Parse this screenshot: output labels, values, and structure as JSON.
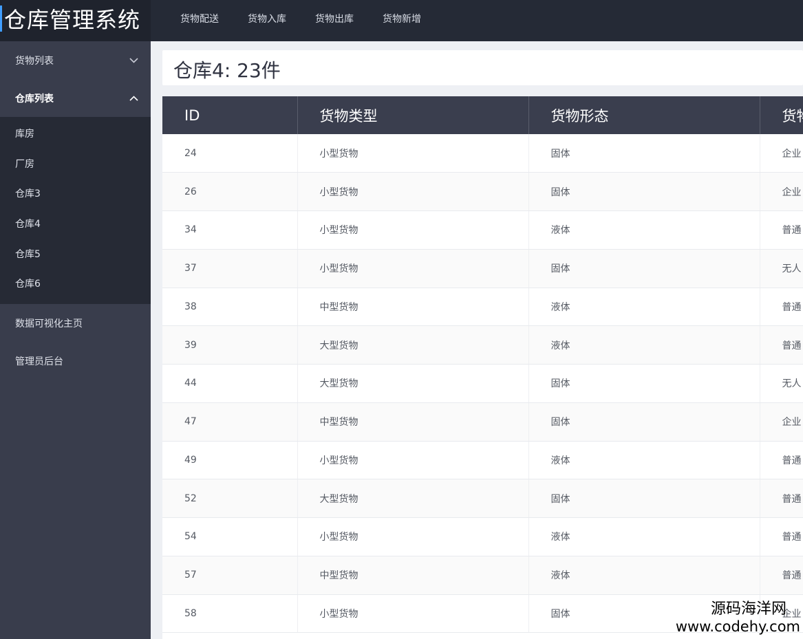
{
  "app": {
    "title": "仓库管理系统"
  },
  "topnav": {
    "items": [
      "货物配送",
      "货物入库",
      "货物出库",
      "货物新增"
    ]
  },
  "sidebar": {
    "goods_list": {
      "label": "货物列表",
      "chevron": "chevron-down-icon"
    },
    "warehouse_list": {
      "label": "仓库列表",
      "chevron": "chevron-up-icon"
    },
    "warehouses": [
      "库房",
      "厂房",
      "仓库3",
      "仓库4",
      "仓库5",
      "仓库6"
    ],
    "dashboard": "数据可视化主页",
    "admin": "管理员后台"
  },
  "page": {
    "heading": "仓库4: 23件"
  },
  "table": {
    "columns": [
      "ID",
      "货物类型",
      "货物形态",
      "货物"
    ],
    "rows": [
      [
        "24",
        "小型货物",
        "固体",
        "企业"
      ],
      [
        "26",
        "小型货物",
        "固体",
        "企业"
      ],
      [
        "34",
        "小型货物",
        "液体",
        "普通"
      ],
      [
        "37",
        "小型货物",
        "固体",
        "无人"
      ],
      [
        "38",
        "中型货物",
        "液体",
        "普通"
      ],
      [
        "39",
        "大型货物",
        "液体",
        "普通"
      ],
      [
        "44",
        "大型货物",
        "固体",
        "无人"
      ],
      [
        "47",
        "中型货物",
        "固体",
        "企业"
      ],
      [
        "49",
        "小型货物",
        "液体",
        "普通"
      ],
      [
        "52",
        "大型货物",
        "固体",
        "普通"
      ],
      [
        "54",
        "小型货物",
        "液体",
        "普通"
      ],
      [
        "57",
        "中型货物",
        "液体",
        "普通"
      ],
      [
        "58",
        "小型货物",
        "固体",
        "企业"
      ]
    ]
  },
  "watermark": {
    "name": "源码海洋网",
    "url": "www.codehy.com"
  },
  "colors": {
    "sidebar": "#393d4c",
    "submenu": "#262a35",
    "topbar": "#252a36",
    "table_header": "#3a3e4e",
    "accent": "#409eff"
  }
}
